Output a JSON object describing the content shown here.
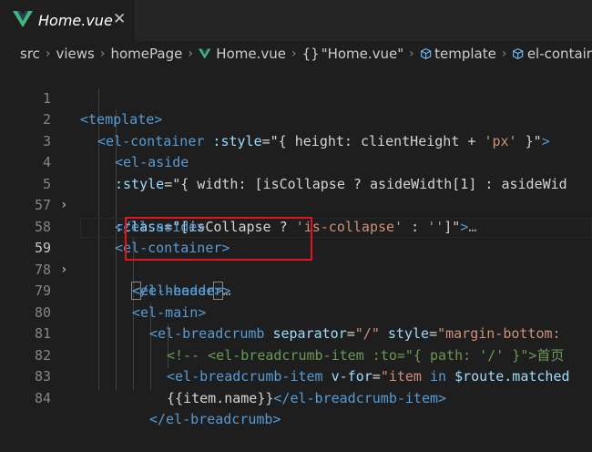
{
  "tab": {
    "title": "Home.vue",
    "close": "✕",
    "icon": "vue-icon"
  },
  "breadcrumb": {
    "items": [
      "src",
      "views",
      "homePage",
      "Home.vue",
      "\"Home.vue\"",
      "template",
      "el-contair"
    ],
    "brace": "{}",
    "separator": "›"
  },
  "editor": {
    "line_numbers": [
      "1",
      "2",
      "3",
      "4",
      "5",
      "57",
      "58",
      "59",
      "78",
      "79",
      "80",
      "81",
      "82",
      "83",
      "84"
    ],
    "fold_markers": {
      "5": "›",
      "59": "›"
    },
    "lines": {
      "l1": [
        "<template>"
      ],
      "l2": [
        "<el-container",
        " :style",
        "=",
        "\"{ height: clientHeight + ",
        "'px'",
        " }\"",
        ">"
      ],
      "l3": [
        "<el-aside"
      ],
      "l4": [
        ":style",
        "=",
        "\"{ width: [isCollapse ? asideWidth[1] : asideWid"
      ],
      "l5": [
        ":class",
        "=",
        "\"[isCollapse ? ",
        "'is-collapse'",
        " : ",
        "''",
        "]\"",
        ">",
        "…"
      ],
      "l57": [
        "</el-aside>"
      ],
      "l58": [
        "<el-container>"
      ],
      "l59": [
        "<",
        "el-header",
        ">",
        "…"
      ],
      "l78": [
        "</el-header>"
      ],
      "l79": [
        "<el-main>"
      ],
      "l80": [
        "<el-breadcrumb",
        " separator",
        "=",
        "\"/\"",
        " style",
        "=",
        "\"margin-bottom: "
      ],
      "l81": [
        "<!-- <el-breadcrumb-item :to=\"{ path: '/' }\">首页"
      ],
      "l82": [
        "<el-breadcrumb-item",
        " v-for",
        "=",
        "\"item ",
        "in",
        " $route.matched"
      ],
      "l83": [
        "{{item.name}}",
        "</el-breadcrumb-item>"
      ],
      "l84": [
        "</el-breadcrumb>"
      ]
    }
  },
  "colors": {
    "background": "#1e1e1e",
    "tag": "#569cd6",
    "attr": "#9cdcfe",
    "string": "#ce9178",
    "comment": "#6a9955",
    "highlight_box": "#e0141e"
  }
}
